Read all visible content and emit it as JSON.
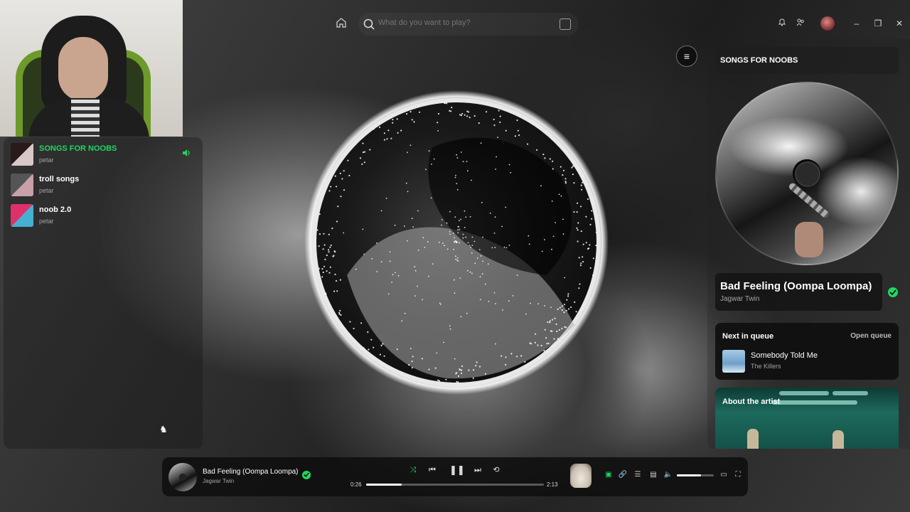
{
  "search": {
    "placeholder": "What do you want to play?"
  },
  "sidebar": {
    "playlists": [
      {
        "name": "SONGS FOR NOOBS",
        "owner": "petar",
        "active": true,
        "colors": [
          "#2a1a1a",
          "#d8c8c8",
          "#b22",
          "#333"
        ]
      },
      {
        "name": "troll songs",
        "owner": "petar",
        "active": false,
        "colors": [
          "#555",
          "#9a7a6a",
          "#c8a0a8",
          "#704050"
        ]
      },
      {
        "name": "noob 2.0",
        "owner": "petar",
        "active": false,
        "colors": [
          "#e0306a",
          "#6a2a7a",
          "#1a1a1a",
          "#46b0d0"
        ]
      }
    ]
  },
  "right_panel": {
    "playlist_title": "SONGS FOR NOOBS",
    "track": {
      "title": "Bad Feeling (Oompa Loompa)",
      "artist": "Jagwar Twin"
    },
    "queue": {
      "heading": "Next in queue",
      "open_label": "Open queue",
      "next": {
        "title": "Somebody Told Me",
        "artist": "The Killers"
      }
    },
    "about_artist_label": "About the artist"
  },
  "player": {
    "title": "Bad Feeling (Oompa Loompa)",
    "artist": "Jagwar Twin",
    "elapsed": "0:26",
    "duration": "2:13",
    "progress_fraction": 0.2,
    "volume_fraction": 0.65
  },
  "colors": {
    "accent_green": "#1ed760",
    "active_playlist_text": "#1ed760"
  },
  "icons": {
    "top": [
      "home-icon",
      "search-icon",
      "browse-icon",
      "bell-icon",
      "friends-icon",
      "avatar",
      "minimize-icon",
      "restore-icon",
      "close-icon"
    ],
    "player": [
      "shuffle-icon",
      "previous-icon",
      "pause-icon",
      "next-icon",
      "repeat-icon",
      "now-playing-view-icon",
      "connect-icon",
      "queue-icon",
      "devices-icon",
      "volume-icon",
      "mini-player-icon",
      "fullscreen-icon"
    ]
  }
}
